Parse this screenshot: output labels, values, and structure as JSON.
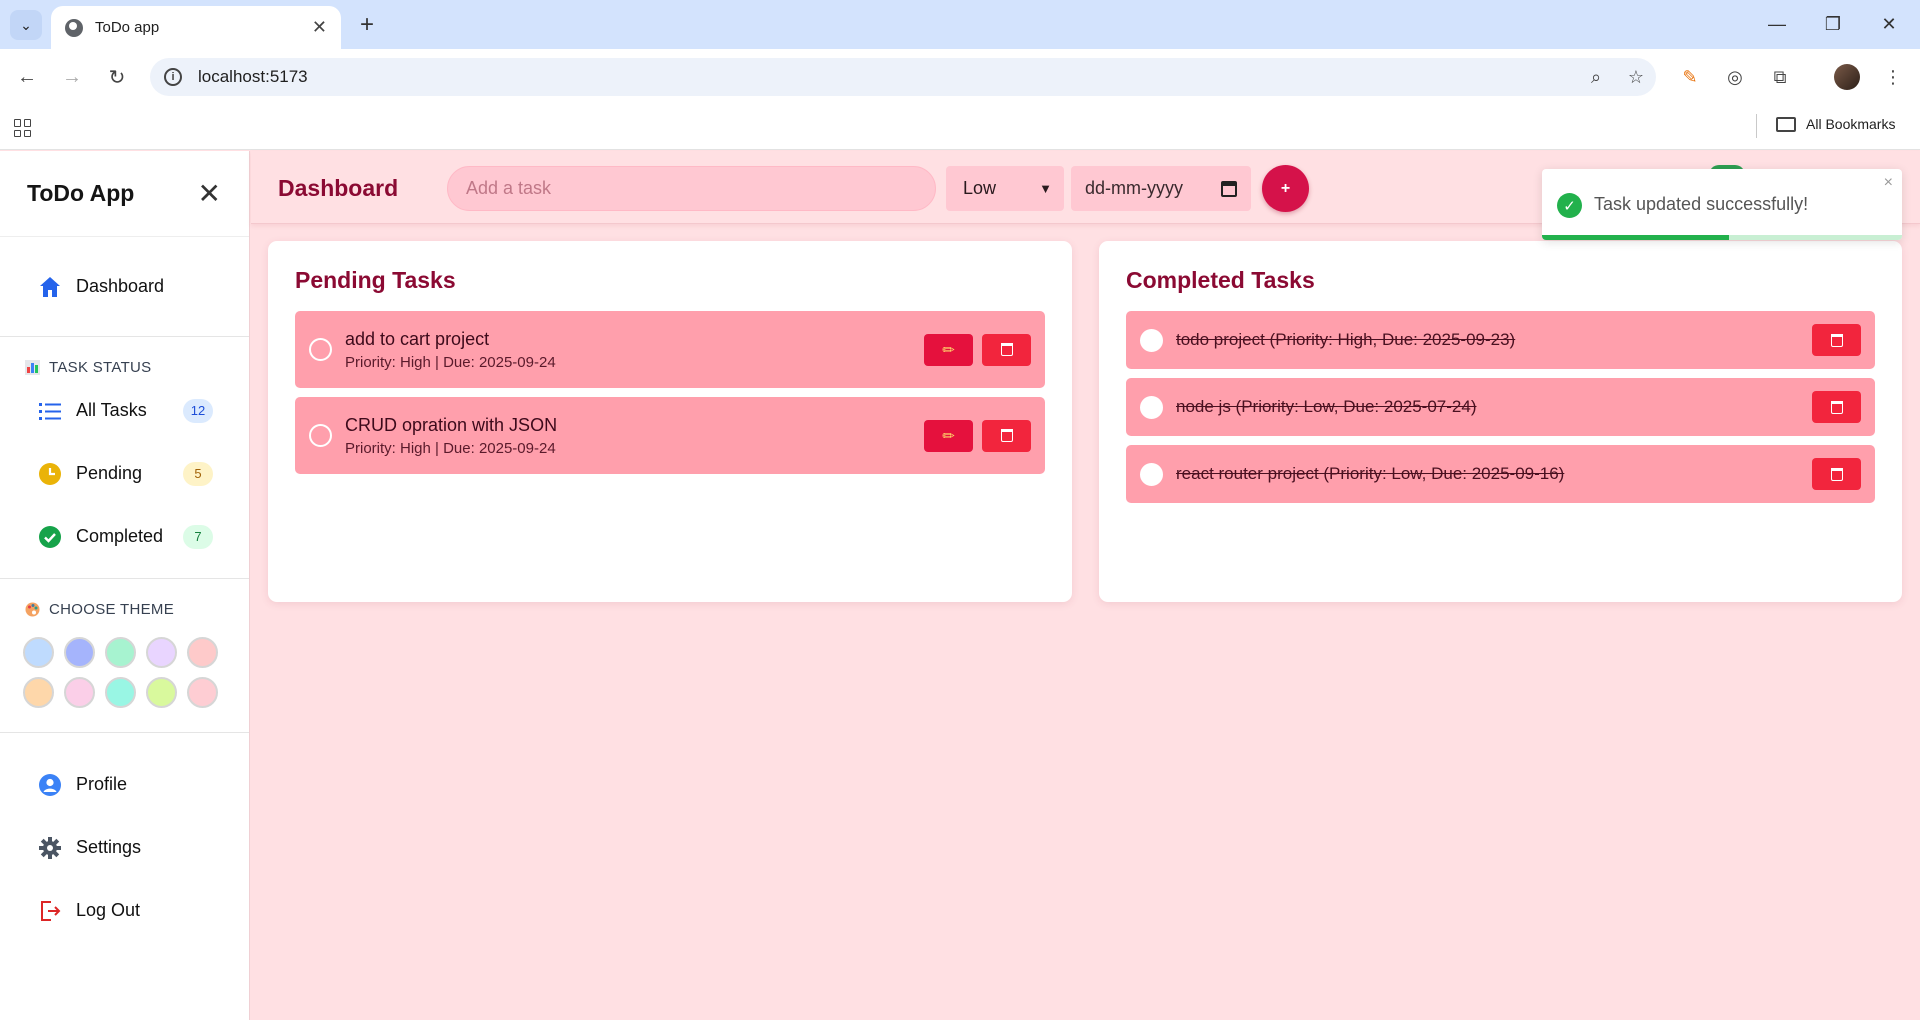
{
  "browser": {
    "tab_title": "ToDo app",
    "url": "localhost:5173",
    "bookmarks_label": "All Bookmarks"
  },
  "sidebar": {
    "app_title": "ToDo App",
    "dashboard_label": "Dashboard",
    "status_section_label": "TASK STATUS",
    "status_items": [
      {
        "label": "All Tasks",
        "count": "12",
        "badge_bg": "#dbeafe",
        "badge_fg": "#1d4ed8"
      },
      {
        "label": "Pending",
        "count": "5",
        "badge_bg": "#fef3c7",
        "badge_fg": "#a16207"
      },
      {
        "label": "Completed",
        "count": "7",
        "badge_bg": "#dcfce7",
        "badge_fg": "#15803d"
      }
    ],
    "theme_section_label": "CHOOSE THEME",
    "theme_colors": [
      "#bfdbfe",
      "#a5b4fc",
      "#a7f3d0",
      "#e9d5ff",
      "#fecaca",
      "#fed7aa",
      "#fbcfe8",
      "#99f6e4",
      "#d9f99d",
      "#fecdd3"
    ],
    "bottom_items": [
      {
        "label": "Profile"
      },
      {
        "label": "Settings"
      },
      {
        "label": "Log Out"
      }
    ]
  },
  "topbar": {
    "title": "Dashboard",
    "task_placeholder": "Add a task",
    "priority_value": "Low",
    "date_placeholder": "dd-mm-yyyy",
    "add_label": "+"
  },
  "pending": {
    "title": "Pending Tasks",
    "tasks": [
      {
        "name": "add to cart project",
        "meta": "Priority: High | Due: 2025-09-24"
      },
      {
        "name": "CRUD opration with JSON",
        "meta": "Priority: High | Due: 2025-09-24"
      }
    ]
  },
  "completed": {
    "title": "Completed Tasks",
    "tasks": [
      {
        "text": "todo project (Priority: High, Due: 2025-09-23)"
      },
      {
        "text": "node js (Priority: Low, Due: 2025-07-24)"
      },
      {
        "text": "react router project (Priority: Low, Due: 2025-09-16)"
      }
    ]
  },
  "toast": {
    "message": "Task updated successfully!",
    "close": "×",
    "progress": 0.52
  },
  "colors": {
    "accent": "#8b0a33",
    "task_bg": "#ff9fac",
    "page_bg": "#ffe0e3"
  }
}
